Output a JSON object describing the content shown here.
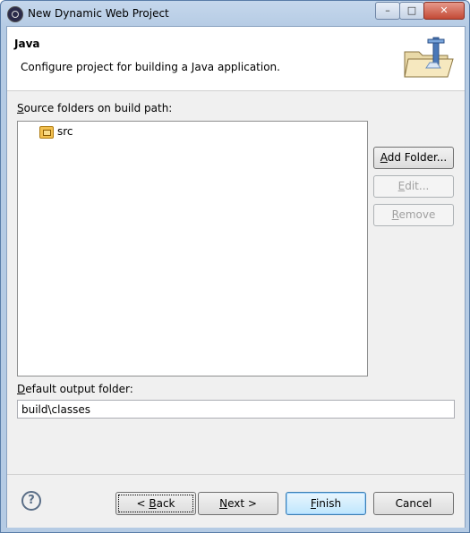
{
  "window": {
    "title": "New Dynamic Web Project",
    "minimize_glyph": "–",
    "maximize_glyph": "□",
    "close_glyph": "✕"
  },
  "header": {
    "title": "Java",
    "description": "Configure project for building a Java application."
  },
  "source": {
    "label_mnemonic": "S",
    "label_rest": "ource folders on build path:",
    "items": [
      {
        "label": "src",
        "icon": "source-folder-icon"
      }
    ],
    "buttons": {
      "add_folder": {
        "mnemonic": "A",
        "rest": "dd Folder...",
        "enabled": true
      },
      "edit": {
        "mnemonic": "E",
        "rest": "dit...",
        "enabled": false
      },
      "remove": {
        "mnemonic": "R",
        "rest": "emove",
        "enabled": false
      }
    }
  },
  "output": {
    "label_mnemonic": "D",
    "label_rest": "efault output folder:",
    "value": "build\\classes"
  },
  "footer": {
    "help_glyph": "?",
    "back": {
      "prefix": "< ",
      "mnemonic": "B",
      "rest": "ack"
    },
    "next": {
      "mnemonic": "N",
      "rest": "ext >"
    },
    "finish": {
      "mnemonic": "F",
      "rest": "inish"
    },
    "cancel": {
      "label": "Cancel"
    }
  },
  "colors": {
    "window_frame": "#b5cbe4",
    "default_button": "#bee6fd"
  }
}
